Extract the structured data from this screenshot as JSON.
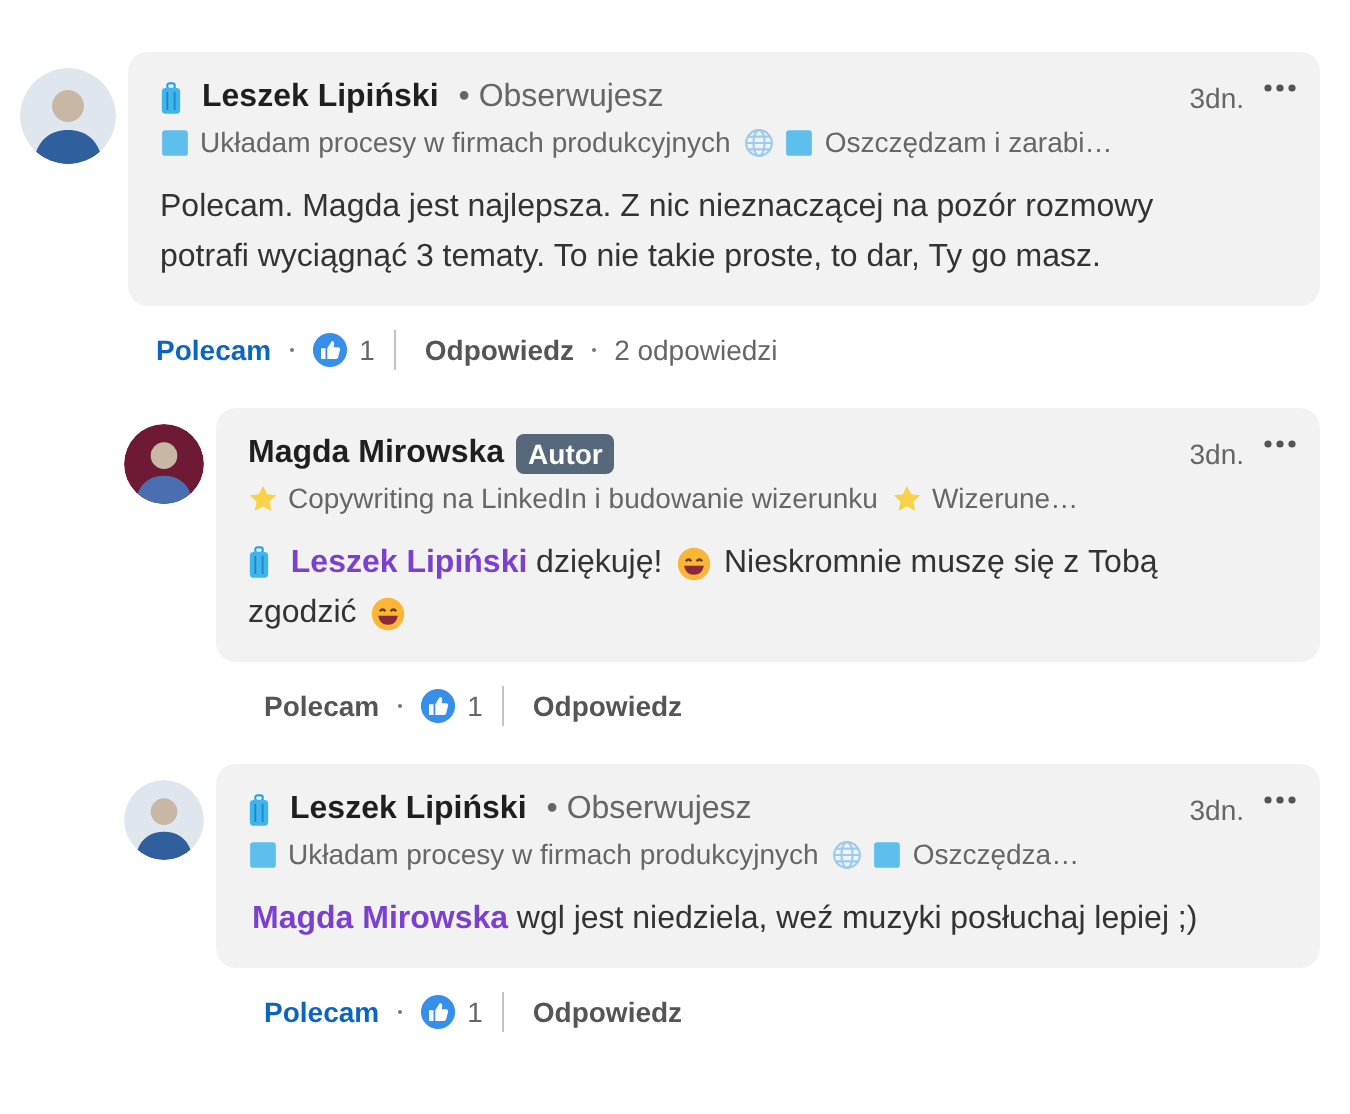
{
  "comments": [
    {
      "author": "Leszek Lipiński",
      "has_badge": true,
      "degree": "• Obserwujesz",
      "time": "3dn.",
      "headline": [
        {
          "kind": "square",
          "text": "Układam procesy w firmach produkcyjnych"
        },
        {
          "kind": "globe"
        },
        {
          "kind": "square",
          "text": "Oszczędzam i zarabi…"
        }
      ],
      "body": [
        {
          "kind": "text",
          "text": "Polecam. Magda jest najlepsza. Z nic nieznaczącej na pozór rozmowy potrafi wyciągnąć 3 tematy. To nie takie proste, to dar, Ty go masz."
        }
      ],
      "actions": {
        "like_label": "Polecam",
        "liked": true,
        "reaction_count": "1",
        "reply_label": "Odpowiedz",
        "replies_count": "2 odpowiedzi"
      },
      "replies": [
        {
          "author": "Magda Mirowska",
          "author_tag": "Autor",
          "time": "3dn.",
          "headline": [
            {
              "kind": "star",
              "text": "Copywriting na LinkedIn i budowanie wizerunku"
            },
            {
              "kind": "star",
              "text": "Wizerune…"
            }
          ],
          "body": [
            {
              "kind": "badge"
            },
            {
              "kind": "mention",
              "text": "Leszek Lipiński"
            },
            {
              "kind": "text",
              "text": "dziękuję!"
            },
            {
              "kind": "emoji"
            },
            {
              "kind": "text",
              "text": "Nieskromnie muszę się z Tobą zgodzić"
            },
            {
              "kind": "emoji"
            }
          ],
          "actions": {
            "like_label": "Polecam",
            "liked": false,
            "reaction_count": "1",
            "reply_label": "Odpowiedz"
          }
        },
        {
          "author": "Leszek Lipiński",
          "has_badge": true,
          "degree": "• Obserwujesz",
          "time": "3dn.",
          "headline": [
            {
              "kind": "square",
              "text": "Układam procesy w firmach produkcyjnych"
            },
            {
              "kind": "globe"
            },
            {
              "kind": "square",
              "text": "Oszczędza…"
            }
          ],
          "body": [
            {
              "kind": "mention",
              "text": "Magda Mirowska"
            },
            {
              "kind": "text",
              "text": "wgl jest niedziela, weź muzyki posłuchaj lepiej ;)"
            }
          ],
          "actions": {
            "like_label": "Polecam",
            "liked": true,
            "reaction_count": "1",
            "reply_label": "Odpowiedz"
          }
        }
      ]
    }
  ]
}
